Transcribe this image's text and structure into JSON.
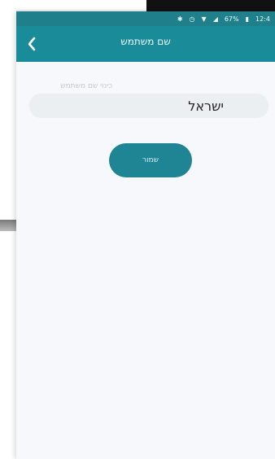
{
  "colors": {
    "accent": "#1a8b98",
    "status_bar": "#1f7f8a",
    "button": "#1f8493"
  },
  "status_bar": {
    "text": "67%",
    "time": "12:4"
  },
  "header": {
    "title": "שם משתמש"
  },
  "form": {
    "label": "כינוי שם משתמש",
    "value": "ישראל",
    "save_label": "שמור"
  }
}
